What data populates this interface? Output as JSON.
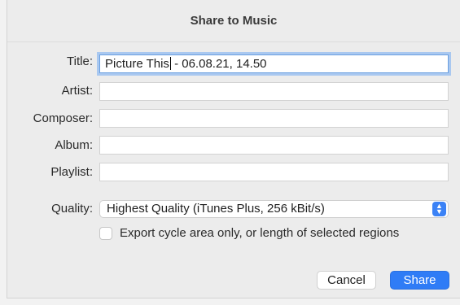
{
  "dialog": {
    "title": "Share to Music"
  },
  "form": {
    "title_label": "Title:",
    "title_value_before_caret": "Picture This",
    "title_value_after_caret": " - 06.08.21, 14.50",
    "artist_label": "Artist:",
    "artist_value": "",
    "composer_label": "Composer:",
    "composer_value": "",
    "album_label": "Album:",
    "album_value": "",
    "playlist_label": "Playlist:",
    "playlist_value": "",
    "quality_label": "Quality:",
    "quality_selected": "Highest Quality (iTunes Plus, 256 kBit/s)",
    "export_checkbox_label": "Export cycle area only, or length of selected regions",
    "export_checked": false
  },
  "buttons": {
    "cancel": "Cancel",
    "share": "Share"
  },
  "icons": {
    "select_arrows": "chevron-up-down-icon",
    "checkbox": "checkbox-icon"
  },
  "colors": {
    "accent": "#2f7cf6",
    "focus_ring": "#a9c8f0"
  }
}
